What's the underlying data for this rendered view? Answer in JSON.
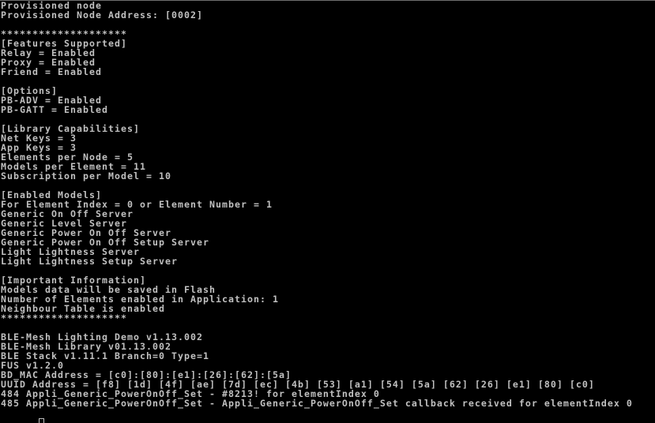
{
  "window": {
    "type": "console",
    "background_color": "#000000",
    "text_color": "#c0c0c0"
  },
  "console_lines": [
    "Provisioned node",
    "Provisioned Node Address: [0002]",
    "",
    "********************",
    "[Features Supported]",
    "Relay = Enabled",
    "Proxy = Enabled",
    "Friend = Enabled",
    "",
    "[Options]",
    "PB-ADV = Enabled",
    "PB-GATT = Enabled",
    "",
    "[Library Capabilities]",
    "Net Keys = 3",
    "App Keys = 3",
    "Elements per Node = 5",
    "Models per Element = 11",
    "Subscription per Model = 10",
    "",
    "[Enabled Models]",
    "For Element Index = 0 or Element Number = 1",
    "Generic On Off Server",
    "Generic Level Server",
    "Generic Power On Off Server",
    "Generic Power On Off Setup Server",
    "Light Lightness Server",
    "Light Lightness Setup Server",
    "",
    "[Important Information]",
    "Models data will be saved in Flash",
    "Number of Elements enabled in Application: 1",
    "Neighbour Table is enabled",
    "********************",
    "",
    "BLE-Mesh Lighting Demo v1.13.002",
    "BLE-Mesh Library v01.13.002",
    "BLE Stack v1.11.1 Branch=0 Type=1",
    "FUS v1.2.0",
    "BD_MAC Address = [c0]:[80]:[e1]:[26]:[62]:[5a]",
    "UUID Address = [f8] [1d] [4f] [ae] [7d] [ec] [4b] [53] [a1] [54] [5a] [62] [26] [e1] [80] [c0]",
    "484 Appli_Generic_PowerOnOff_Set - #8213! for elementIndex 0",
    "485 Appli_Generic_PowerOnOff_Set - Appli_Generic_PowerOnOff_Set callback received for elementIndex 0"
  ],
  "prompt": {
    "cursor_icon": "block-cursor-outline",
    "text": ""
  }
}
